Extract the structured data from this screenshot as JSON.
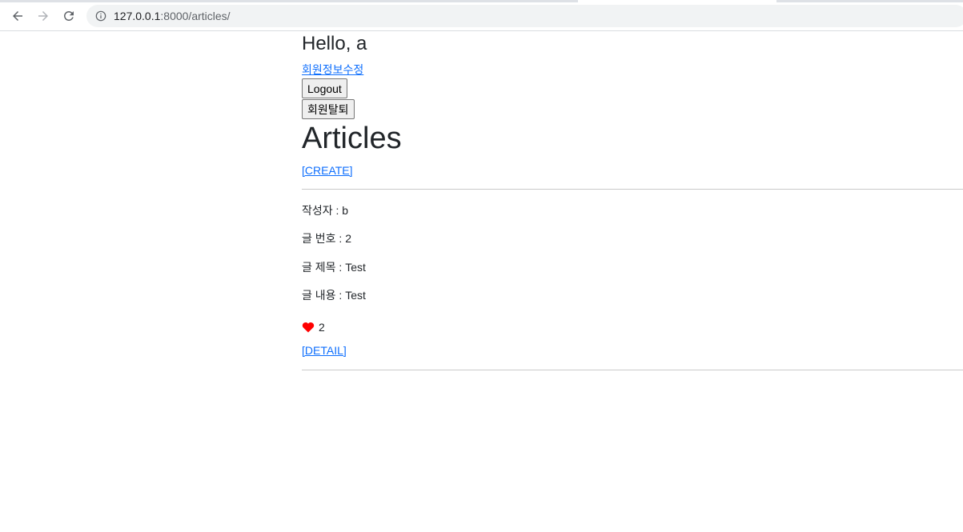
{
  "browser": {
    "url_host": "127.0.0.1",
    "url_path": ":8000/articles/"
  },
  "header": {
    "greeting": "Hello, a",
    "edit_profile_link": "회원정보수정",
    "logout_button": "Logout",
    "withdraw_button": "회원탈퇴"
  },
  "main": {
    "title": "Articles",
    "create_link": "[CREATE]"
  },
  "articles": [
    {
      "author_line": "작성자 : b",
      "number_line": "글 번호 : 2",
      "title_line": "글 제목 : Test",
      "content_line": "글 내용 : Test",
      "like_count": "2",
      "detail_link": "[DETAIL]"
    }
  ],
  "colors": {
    "link": "#0d6efd",
    "heart": "#ff0000"
  },
  "icons": {
    "back": "arrow-left-icon",
    "forward": "arrow-right-icon",
    "reload": "reload-icon",
    "site_info": "info-icon",
    "like": "heart-icon"
  }
}
